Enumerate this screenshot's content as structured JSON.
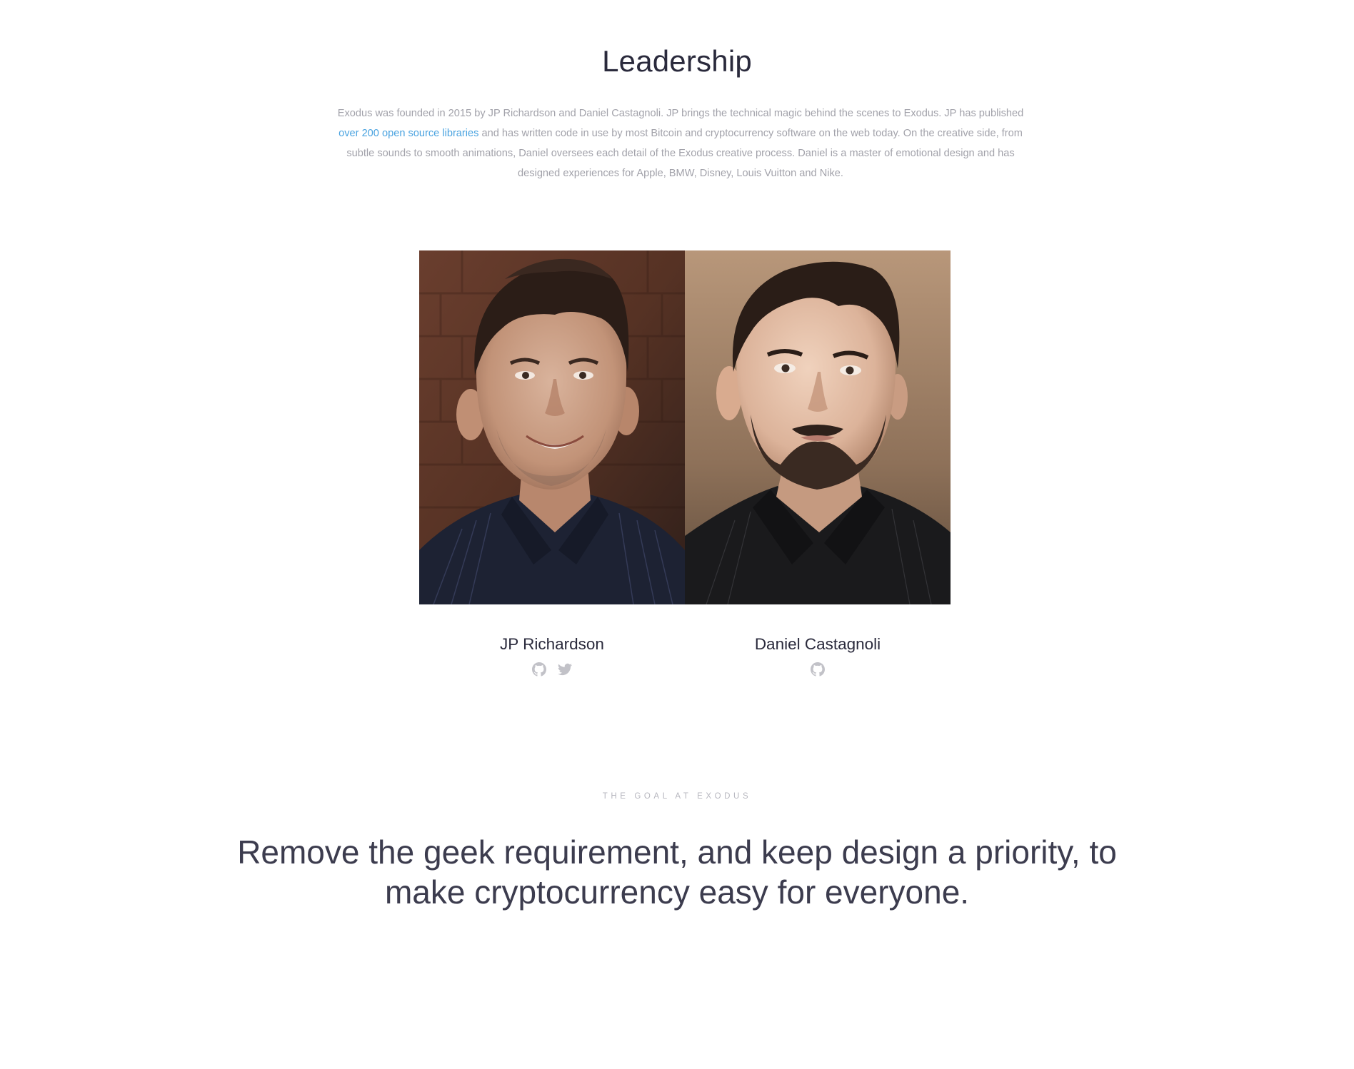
{
  "leadership": {
    "title": "Leadership",
    "intro": {
      "part1": "Exodus was founded in 2015 by JP Richardson and Daniel Castagnoli. JP brings the technical magic behind the scenes to Exodus. JP has published ",
      "link": "over 200 open source libraries",
      "part2": " and has written code in use by most Bitcoin and cryptocurrency software on the web today. On the creative side, from subtle sounds to smooth animations, Daniel oversees each detail of the Exodus creative process. Daniel is a master of emotional design and has designed experiences for Apple, BMW, Disney, Louis Vuitton and Nike."
    },
    "people": [
      {
        "name": "JP Richardson",
        "icons": [
          "github-icon",
          "twitter-icon"
        ]
      },
      {
        "name": "Daniel Castagnoli",
        "icons": [
          "github-icon"
        ]
      }
    ]
  },
  "goal": {
    "eyebrow": "THE GOAL AT EXODUS",
    "statement": "Remove the geek requirement, and keep design a priority, to make cryptocurrency easy for everyone."
  },
  "colors": {
    "link": "#4aa3e0",
    "muted_text": "#a2a2aa",
    "icon": "#c2c2c8"
  }
}
